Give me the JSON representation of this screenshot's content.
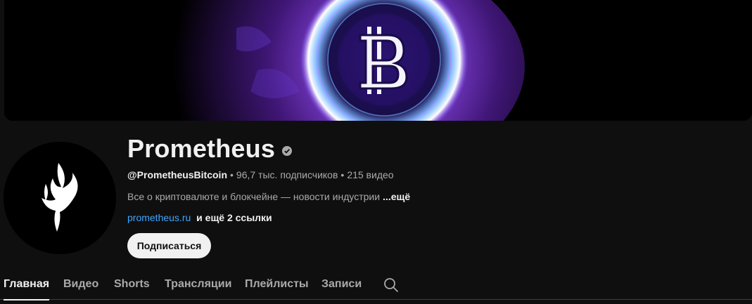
{
  "channel": {
    "name": "Prometheus",
    "handle": "@PrometheusBitcoin",
    "subscribers": "96,7 тыс. подписчиков",
    "videos": "215 видео",
    "separator": "•",
    "description": "Все о криптовалюте и блокчейне — новости индустрии",
    "description_more": "...ещё",
    "link": "prometheus.ru",
    "extra_links": "и ещё 2 ссылки",
    "subscribe_label": "Подписаться",
    "verified_icon": "verified-check-icon"
  },
  "tabs": [
    {
      "label": "Главная",
      "active": true
    },
    {
      "label": "Видео",
      "active": false
    },
    {
      "label": "Shorts",
      "active": false
    },
    {
      "label": "Трансляции",
      "active": false
    },
    {
      "label": "Плейлисты",
      "active": false
    },
    {
      "label": "Записи",
      "active": false
    }
  ],
  "search_icon": "search-icon",
  "banner": {
    "icon": "bitcoin-icon"
  },
  "avatar": {
    "icon": "flame-logo-icon"
  },
  "colors": {
    "background": "#0f0f0f",
    "text_primary": "#f1f1f1",
    "text_secondary": "#aaaaaa",
    "link": "#3ea6ff",
    "subscribe_bg": "#f1f1f1",
    "banner_accent": "#8a3cff"
  }
}
